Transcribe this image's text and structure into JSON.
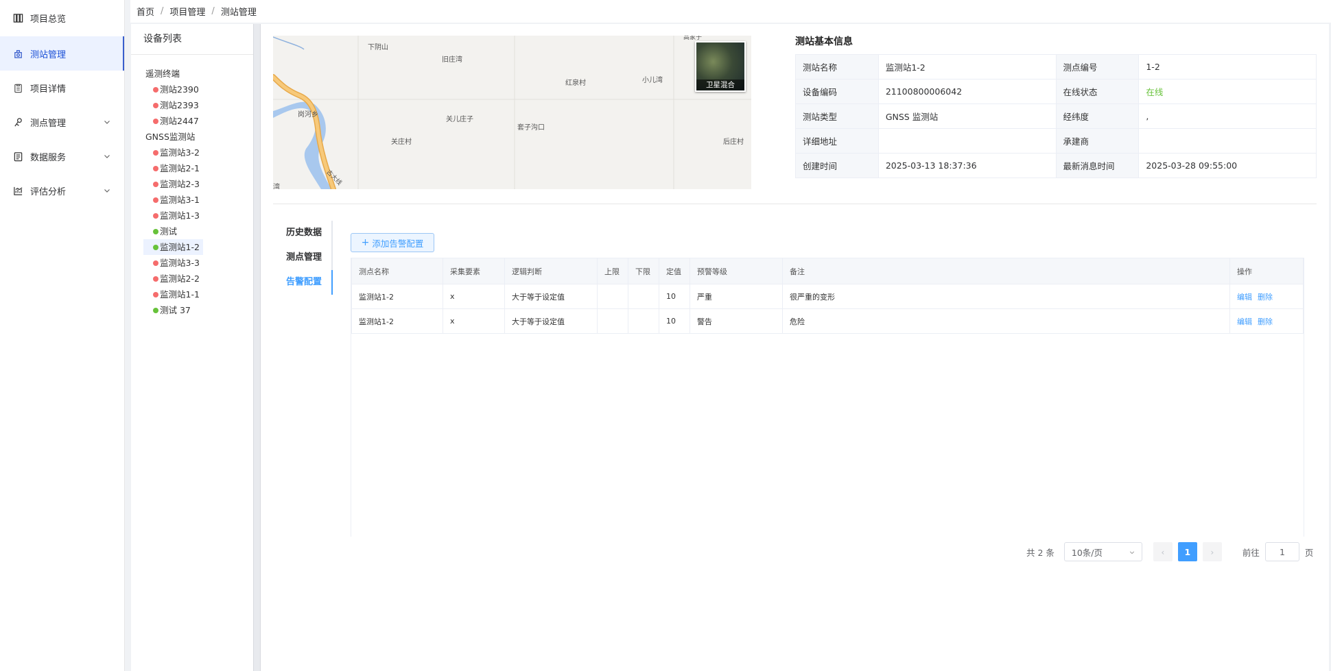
{
  "sidebar": {
    "items": [
      {
        "label": "项目总览",
        "icon": "columns-icon"
      },
      {
        "label": "测站管理",
        "icon": "station-icon",
        "active": true
      },
      {
        "label": "项目详情",
        "icon": "clipboard-icon"
      },
      {
        "label": "测点管理",
        "icon": "measure-point-icon",
        "expandable": true
      },
      {
        "label": "数据服务",
        "icon": "document-icon",
        "expandable": true
      },
      {
        "label": "评估分析",
        "icon": "chart-icon",
        "expandable": true
      }
    ]
  },
  "breadcrumb": [
    "首页",
    "项目管理",
    "测站管理"
  ],
  "device_panel": {
    "title": "设备列表",
    "groups": [
      {
        "name": "遥测终端",
        "items": [
          {
            "name": "测站2390",
            "status": "red"
          },
          {
            "name": "测站2393",
            "status": "red"
          },
          {
            "name": "测站2447",
            "status": "red"
          }
        ]
      },
      {
        "name": "GNSS监测站",
        "items": [
          {
            "name": "监测站3-2",
            "status": "red"
          },
          {
            "name": "监测站2-1",
            "status": "red"
          },
          {
            "name": "监测站2-3",
            "status": "red"
          },
          {
            "name": "监测站3-1",
            "status": "red"
          },
          {
            "name": "监测站1-3",
            "status": "red"
          },
          {
            "name": "测试",
            "status": "green"
          },
          {
            "name": "监测站1-2",
            "status": "green",
            "selected": true
          },
          {
            "name": "监测站3-3",
            "status": "red"
          },
          {
            "name": "监测站2-2",
            "status": "red"
          },
          {
            "name": "监测站1-1",
            "status": "red"
          },
          {
            "name": "测试 37",
            "status": "green"
          }
        ]
      }
    ]
  },
  "map": {
    "labels": [
      "下阴山",
      "旧庄湾",
      "红泉村",
      "小儿湾",
      "岗河乡",
      "关儿庄子",
      "套子沟口",
      "关庄村",
      "后庄村",
      "湾",
      "古大线",
      "高家子"
    ],
    "satellite_label": "卫星混合"
  },
  "station_info": {
    "title": "测站基本信息",
    "rows": [
      {
        "k1": "测站名称",
        "v1": "监测站1-2",
        "k2": "测点编号",
        "v2": "1-2"
      },
      {
        "k1": "设备编码",
        "v1": "21100800006042",
        "k2": "在线状态",
        "v2": "在线"
      },
      {
        "k1": "测站类型",
        "v1": "GNSS 监测站",
        "k2": "经纬度",
        "v2": ","
      },
      {
        "k1": "详细地址",
        "v1": "",
        "k2": "承建商",
        "v2": ""
      },
      {
        "k1": "创建时间",
        "v1": "2025-03-13 18:37:36",
        "k2": "最新消息时间",
        "v2": "2025-03-28 09:55:00"
      }
    ]
  },
  "tabs": [
    "历史数据",
    "测点管理",
    "告警配置"
  ],
  "active_tab": "告警配置",
  "add_button": "添加告警配置",
  "alarm_table": {
    "columns": [
      "测点名称",
      "采集要素",
      "逻辑判断",
      "上限",
      "下限",
      "定值",
      "预警等级",
      "备注",
      "操作"
    ],
    "rows": [
      {
        "point": "监测站1-2",
        "element": "x",
        "logic": "大于等于设定值",
        "upper": "",
        "lower": "",
        "value": "10",
        "level": "严重",
        "remark": "很严重的变形"
      },
      {
        "point": "监测站1-2",
        "element": "x",
        "logic": "大于等于设定值",
        "upper": "",
        "lower": "",
        "value": "10",
        "level": "警告",
        "remark": "危险"
      }
    ],
    "actions": {
      "edit": "编辑",
      "delete": "删除"
    }
  },
  "pagination": {
    "total": "共 2 条",
    "page_size": "10条/页",
    "current_page": "1",
    "goto_prefix": "前往",
    "goto_value": "1",
    "goto_suffix": "页"
  },
  "colors": {
    "accent": "#409eff",
    "online": "#67c23a",
    "offline": "#f56c6c",
    "sidebar_active": "#1a4fd6"
  }
}
